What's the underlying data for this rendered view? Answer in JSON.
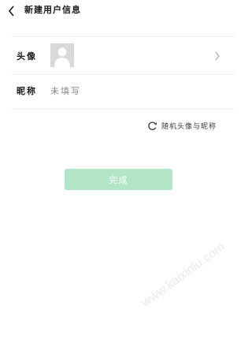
{
  "header": {
    "back_icon": "chevron-left-icon",
    "title": "新建用户信息"
  },
  "avatar_row": {
    "label": "头像",
    "avatar_icon": "person-placeholder-icon",
    "arrow_icon": "chevron-right-icon"
  },
  "nickname_row": {
    "label": "昵称",
    "value": "未填写"
  },
  "random": {
    "icon": "refresh-icon",
    "label": "随机头像与昵称"
  },
  "done_button": {
    "label": "完成",
    "color": "#b3e6c7"
  },
  "watermark": "www.kaixinlu.com"
}
